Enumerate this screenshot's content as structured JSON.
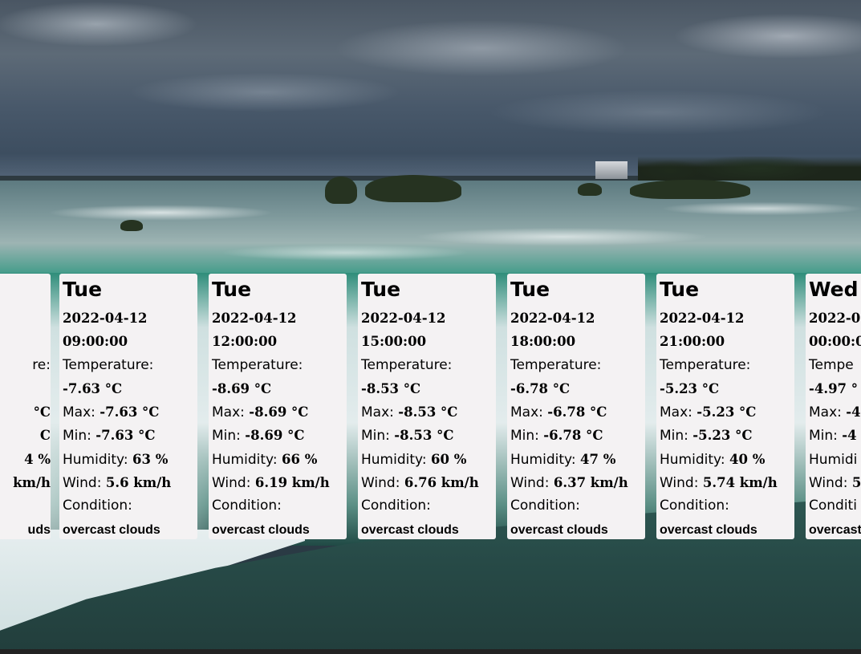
{
  "forecast": {
    "cards": [
      {
        "day": "",
        "date": "",
        "time": "",
        "temperature_label": "re:",
        "temperature": "",
        "max_label": "",
        "max": "°C",
        "min_label": "",
        "min": "C",
        "humidity_label": "",
        "humidity": "4 %",
        "wind_label": "",
        "wind": "km/h",
        "condition_label": "",
        "condition": "uds"
      },
      {
        "day": "Tue",
        "date": "2022-04-12",
        "time": "09:00:00",
        "temperature_label": "Temperature:",
        "temperature": "-7.63 °C",
        "max_label": "Max: ",
        "max": "-7.63 °C",
        "min_label": "Min: ",
        "min": "-7.63 °C",
        "humidity_label": "Humidity: ",
        "humidity": "63 %",
        "wind_label": "Wind: ",
        "wind": "5.6 km/h",
        "condition_label": "Condition:",
        "condition": "overcast clouds"
      },
      {
        "day": "Tue",
        "date": "2022-04-12",
        "time": "12:00:00",
        "temperature_label": "Temperature:",
        "temperature": "-8.69 °C",
        "max_label": "Max: ",
        "max": "-8.69 °C",
        "min_label": "Min: ",
        "min": "-8.69 °C",
        "humidity_label": "Humidity: ",
        "humidity": "66 %",
        "wind_label": "Wind: ",
        "wind": "6.19 km/h",
        "condition_label": "Condition:",
        "condition": "overcast clouds"
      },
      {
        "day": "Tue",
        "date": "2022-04-12",
        "time": "15:00:00",
        "temperature_label": "Temperature:",
        "temperature": "-8.53 °C",
        "max_label": "Max: ",
        "max": "-8.53 °C",
        "min_label": "Min: ",
        "min": "-8.53 °C",
        "humidity_label": "Humidity: ",
        "humidity": "60 %",
        "wind_label": "Wind: ",
        "wind": "6.76 km/h",
        "condition_label": "Condition:",
        "condition": "overcast clouds"
      },
      {
        "day": "Tue",
        "date": "2022-04-12",
        "time": "18:00:00",
        "temperature_label": "Temperature:",
        "temperature": "-6.78 °C",
        "max_label": "Max: ",
        "max": "-6.78 °C",
        "min_label": "Min: ",
        "min": "-6.78 °C",
        "humidity_label": "Humidity: ",
        "humidity": "47 %",
        "wind_label": "Wind: ",
        "wind": "6.37 km/h",
        "condition_label": "Condition:",
        "condition": "overcast clouds"
      },
      {
        "day": "Tue",
        "date": "2022-04-12",
        "time": "21:00:00",
        "temperature_label": "Temperature:",
        "temperature": "-5.23 °C",
        "max_label": "Max: ",
        "max": "-5.23 °C",
        "min_label": "Min: ",
        "min": "-5.23 °C",
        "humidity_label": "Humidity: ",
        "humidity": "40 %",
        "wind_label": "Wind: ",
        "wind": "5.74 km/h",
        "condition_label": "Condition:",
        "condition": "overcast clouds"
      },
      {
        "day": "Wed",
        "date": "2022-0",
        "time": "00:00:0",
        "temperature_label": "Tempe",
        "temperature": "-4.97 °",
        "max_label": "Max: ",
        "max": "-4",
        "min_label": "Min: ",
        "min": "-4",
        "humidity_label": "Humidi",
        "humidity": "",
        "wind_label": "Wind: ",
        "wind": "5",
        "condition_label": "Conditi",
        "condition": "overcast"
      }
    ]
  }
}
